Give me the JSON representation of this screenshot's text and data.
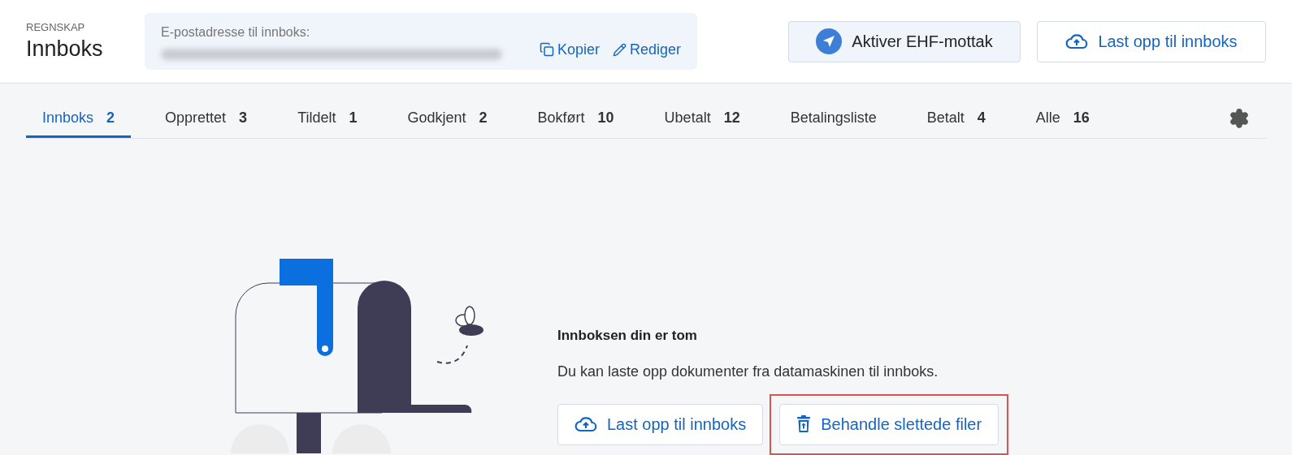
{
  "header": {
    "section": "REGNSKAP",
    "title": "Innboks",
    "email_box": {
      "label": "E-postadresse til innboks:",
      "actions": [
        {
          "kind": "copy",
          "label": "Kopier"
        },
        {
          "kind": "edit",
          "label": "Rediger"
        }
      ]
    },
    "buttons": [
      {
        "kind": "ehf",
        "label": "Aktiver EHF-mottak"
      },
      {
        "kind": "upload",
        "label": "Last opp til innboks"
      }
    ]
  },
  "tabs": [
    {
      "label": "Innboks",
      "count": "2",
      "selected": true
    },
    {
      "label": "Opprettet",
      "count": "3",
      "selected": false
    },
    {
      "label": "Tildelt",
      "count": "1",
      "selected": false
    },
    {
      "label": "Godkjent",
      "count": "2",
      "selected": false
    },
    {
      "label": "Bokført",
      "count": "10",
      "selected": false
    },
    {
      "label": "Ubetalt",
      "count": "12",
      "selected": false
    },
    {
      "label": "Betalingsliste",
      "selected": false
    },
    {
      "label": "Betalt",
      "count": "4",
      "selected": false
    },
    {
      "label": "Alle",
      "count": "16",
      "selected": false
    }
  ],
  "empty_state": {
    "title": "Innboksen din er tom",
    "text": "Du kan laste opp dokumenter fra datamaskinen til innboks.",
    "buttons": [
      {
        "kind": "upload",
        "label": "Last opp til innboks",
        "highlighted": false
      },
      {
        "kind": "trash",
        "label": "Behandle slettede filer",
        "highlighted": true
      }
    ]
  }
}
